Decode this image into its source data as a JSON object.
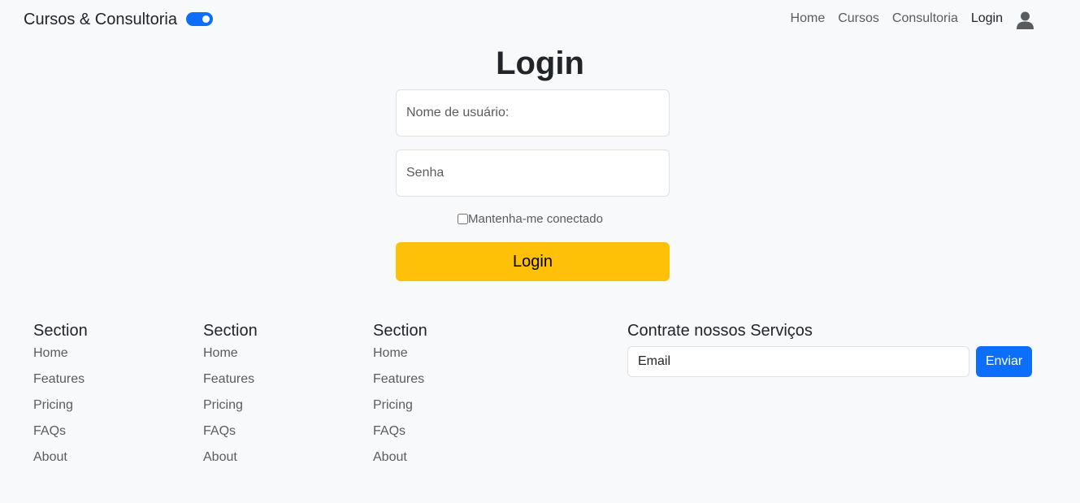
{
  "navbar": {
    "brand": "Cursos & Consultoria",
    "theme_toggle_on": true,
    "links": [
      "Home",
      "Cursos",
      "Consultoria",
      "Login"
    ],
    "user_icon": "user-icon"
  },
  "login": {
    "title": "Login",
    "username_placeholder": "Nome de usuário:",
    "password_placeholder": "Senha",
    "remember_label": "Mantenha-me conectado",
    "button_label": "Login",
    "button_color": "#ffc107"
  },
  "footer": {
    "columns": [
      {
        "title": "Section",
        "links": [
          "Home",
          "Features",
          "Pricing",
          "FAQs",
          "About"
        ]
      },
      {
        "title": "Section",
        "links": [
          "Home",
          "Features",
          "Pricing",
          "FAQs",
          "About"
        ]
      },
      {
        "title": "Section",
        "links": [
          "Home",
          "Features",
          "Pricing",
          "FAQs",
          "About"
        ]
      }
    ],
    "subscribe": {
      "title": "Contrate nossos Serviços",
      "email_placeholder": "Email",
      "button_label": "Enviar",
      "button_color": "#0d6efd"
    }
  }
}
